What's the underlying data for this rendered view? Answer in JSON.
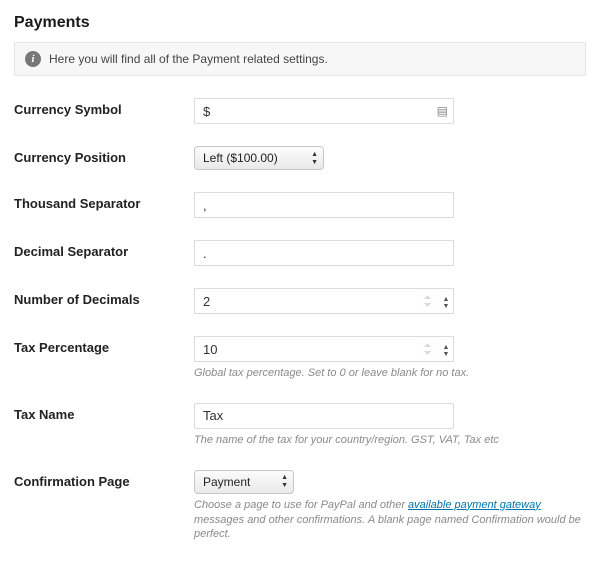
{
  "section": {
    "title": "Payments"
  },
  "notice": {
    "text": "Here you will find all of the Payment related settings."
  },
  "fields": {
    "currency_symbol": {
      "label": "Currency Symbol",
      "value": "$"
    },
    "currency_position": {
      "label": "Currency Position",
      "value": "Left ($100.00)"
    },
    "thousand_sep": {
      "label": "Thousand Separator",
      "value": ","
    },
    "decimal_sep": {
      "label": "Decimal Separator",
      "value": "."
    },
    "num_decimals": {
      "label": "Number of Decimals",
      "value": "2"
    },
    "tax_percentage": {
      "label": "Tax Percentage",
      "value": "10",
      "help": "Global tax percentage. Set to 0 or leave blank for no tax."
    },
    "tax_name": {
      "label": "Tax Name",
      "value": "Tax",
      "help": "The name of the tax for your country/region. GST, VAT, Tax etc"
    },
    "confirmation_page": {
      "label": "Confirmation Page",
      "value": "Payment",
      "help_pre": "Choose a page to use for PayPal and other ",
      "help_link": "available payment gateway",
      "help_post": " messages and other confirmations. A blank page named Confirmation would be perfect."
    }
  }
}
